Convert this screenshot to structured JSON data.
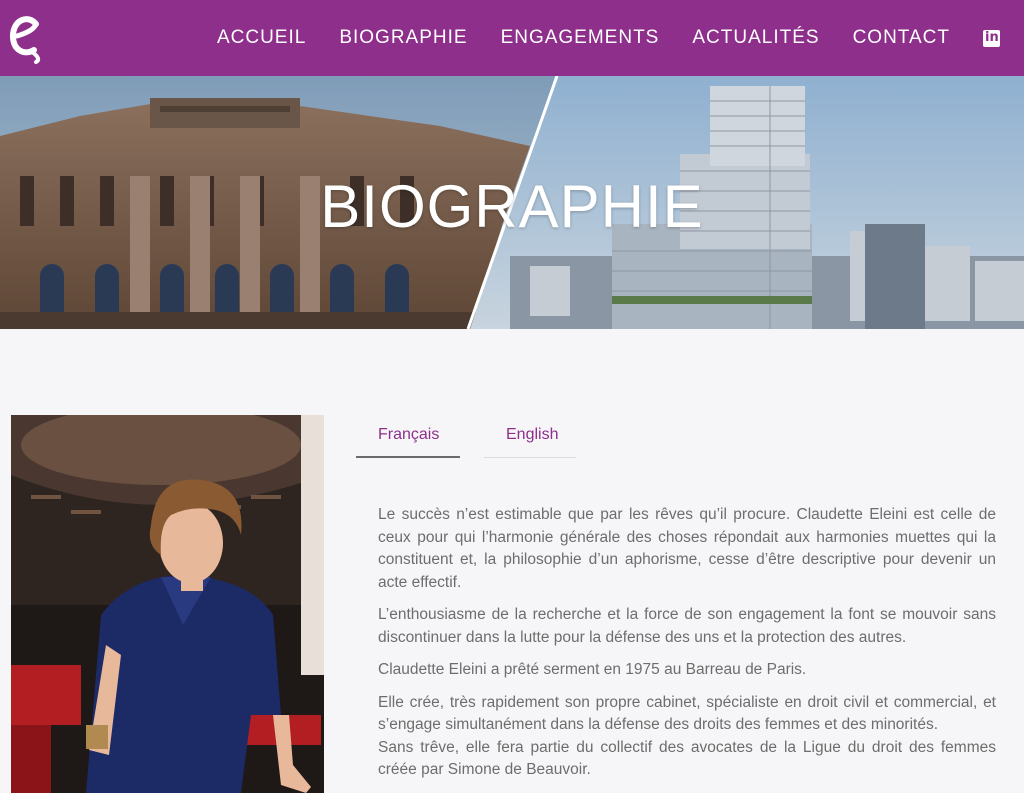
{
  "header": {
    "logo_icon": "e-logo-icon",
    "nav": [
      "ACCUEIL",
      "BIOGRAPHIE",
      "ENGAGEMENTS",
      "ACTUALITÉS",
      "CONTACT"
    ],
    "linkedin_icon": "linkedin-icon"
  },
  "hero": {
    "title": "BIOGRAPHIE"
  },
  "tabs": {
    "french": "Français",
    "english": "English"
  },
  "bio": {
    "p1": "Le succès n’est estimable que par les rêves qu’il procure. Claudette Eleini est celle de ceux pour qui l’harmonie générale des choses répondait aux harmonies muettes qui la constituent et, la philosophie d’un aphorisme, cesse d’être descriptive pour devenir un acte effectif.",
    "p2": "L’enthousiasme de la recherche et la force de son engagement la font se mouvoir sans discontinuer dans la lutte pour la défense des uns et la protection des autres.",
    "p3": "Claudette Eleini a prêté serment en 1975 au Barreau de Paris.",
    "p4": "Elle crée, très rapidement son propre cabinet, spécialiste en droit civil et commercial, et s’engage simultanément dans la défense des droits des femmes et des minorités.",
    "p5": "Sans trêve, elle fera partie du collectif des avocates de la Ligue du droit des femmes créée par Simone de Beauvoir."
  },
  "colors": {
    "brand": "#8e2f8c",
    "text": "#6d6d6d",
    "background": "#f6f6f8"
  }
}
